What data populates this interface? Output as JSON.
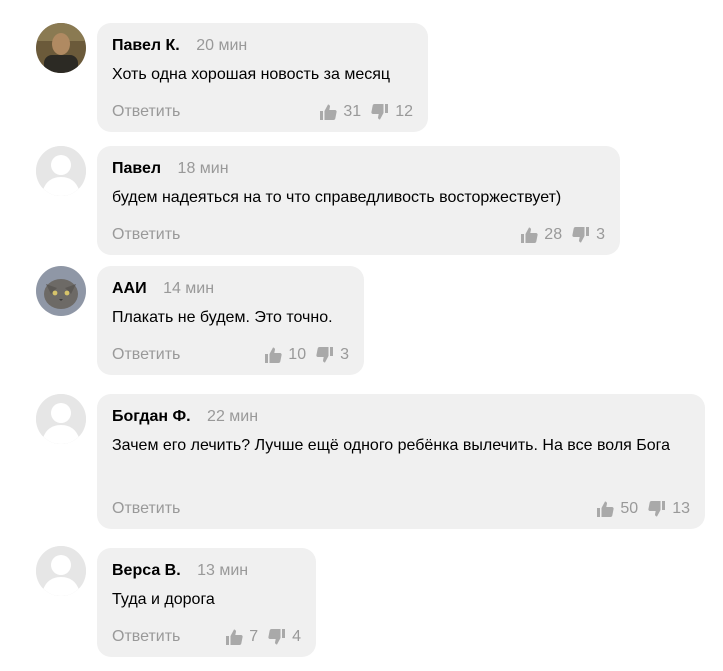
{
  "comments": [
    {
      "author": "Павел К.",
      "time": "20 мин",
      "text": "Хоть одна хорошая новость за месяц",
      "reply_label": "Ответить",
      "likes": "31",
      "dislikes": "12",
      "avatar": "photo-dark"
    },
    {
      "author": "Павел",
      "time": "18 мин",
      "text": "будем надеяться на то что справедливость восторжествует)",
      "reply_label": "Ответить",
      "likes": "28",
      "dislikes": "3",
      "avatar": "default-user-icon"
    },
    {
      "author": "ААИ",
      "time": "14 мин",
      "text": "Плакать не будем. Это точно.",
      "reply_label": "Ответить",
      "likes": "10",
      "dislikes": "3",
      "avatar": "photo-cat"
    },
    {
      "author": "Богдан Ф.",
      "time": "22 мин",
      "text": "Зачем его лечить? Лучше ещё одного ребёнка вылечить. На все воля Бога",
      "reply_label": "Ответить",
      "likes": "50",
      "dislikes": "13",
      "avatar": "default-user-icon"
    },
    {
      "author": "Верса В.",
      "time": "13 мин",
      "text": "Туда и дорога",
      "reply_label": "Ответить",
      "likes": "7",
      "dislikes": "4",
      "avatar": "default-user-icon"
    }
  ],
  "colors": {
    "bubble": "#f0f0f0",
    "meta": "#999999",
    "avatar_placeholder": "#e6e6e6"
  }
}
